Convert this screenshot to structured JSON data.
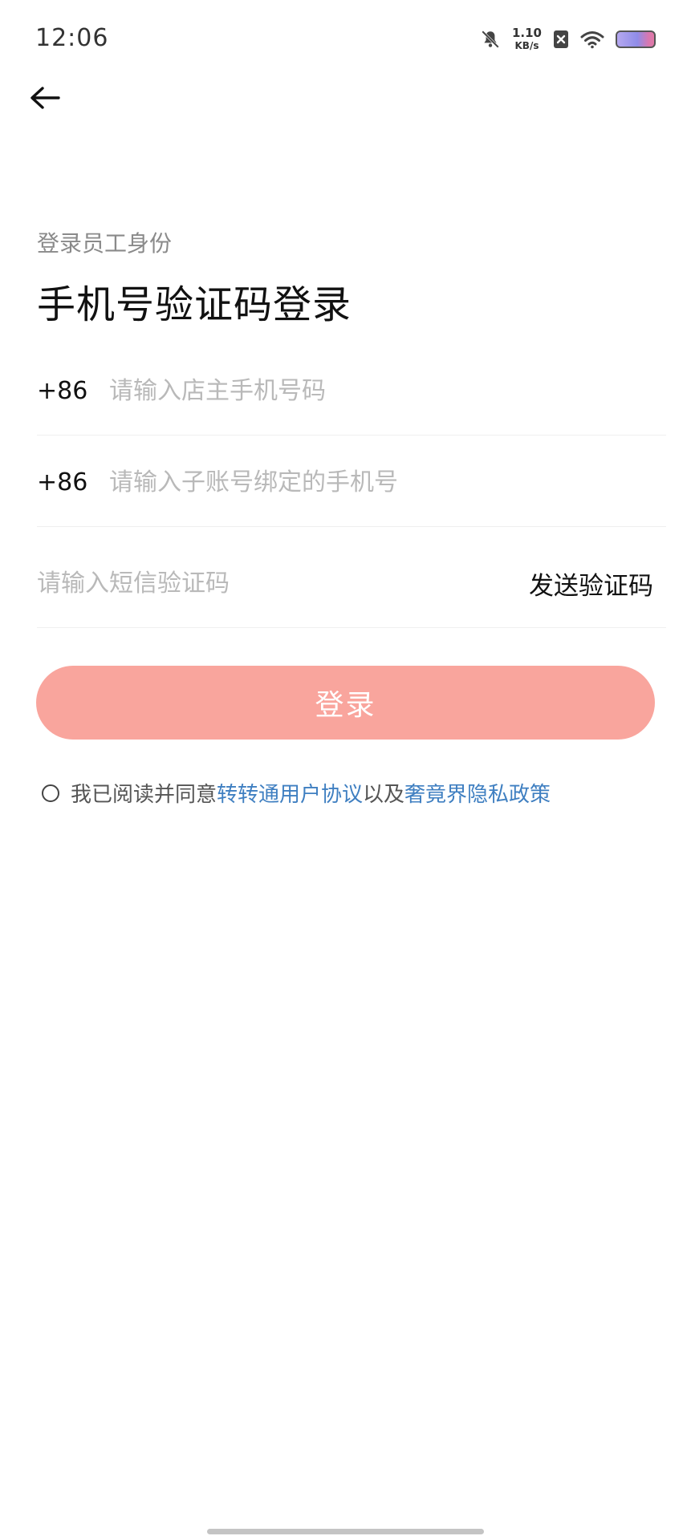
{
  "status_bar": {
    "time": "12:06",
    "net_speed_value": "1.10",
    "net_speed_unit": "KB/s",
    "icons": [
      "bell-off-icon",
      "sim-x-icon",
      "wifi-icon",
      "battery-icon"
    ]
  },
  "nav": {
    "back_icon": "arrow-left-icon"
  },
  "header": {
    "subtitle": "登录员工身份",
    "title": "手机号验证码登录"
  },
  "form": {
    "owner_phone": {
      "prefix": "+86",
      "placeholder": "请输入店主手机号码",
      "value": ""
    },
    "sub_phone": {
      "prefix": "+86",
      "placeholder": "请输入子账号绑定的手机号",
      "value": ""
    },
    "sms_code": {
      "placeholder": "请输入短信验证码",
      "value": "",
      "send_label": "发送验证码"
    },
    "login_label": "登录",
    "login_button_color": "#f9a59d"
  },
  "agreement": {
    "checked": false,
    "prefix_text": "我已阅读并同意",
    "link1": "转转通用户协议",
    "middle_text": "以及",
    "link2": "奢竟界隐私政策",
    "link_color": "#3f7fc1"
  }
}
